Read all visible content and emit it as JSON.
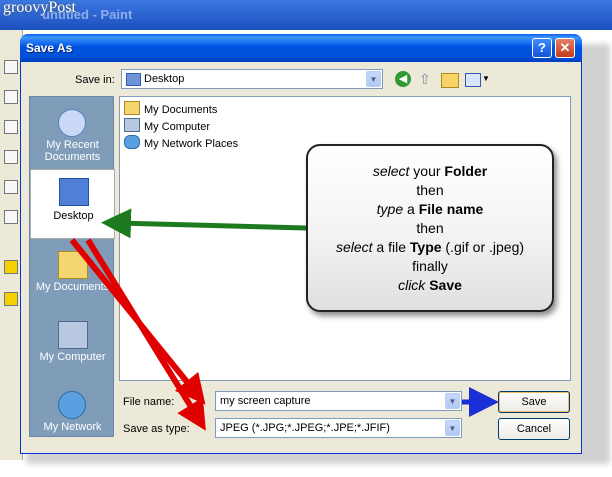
{
  "watermark": "groovyPost",
  "paint": {
    "title": "untitled - Paint"
  },
  "dialog": {
    "title": "Save As",
    "help": "?",
    "close": "✕",
    "save_in_label": "Save in:",
    "save_in_value": "Desktop",
    "places": [
      "My Recent Documents",
      "Desktop",
      "My Documents",
      "My Computer",
      "My Network"
    ],
    "files": [
      "My Documents",
      "My Computer",
      "My Network Places"
    ],
    "file_name_label": "File name:",
    "file_name_value": "my screen capture",
    "save_type_label": "Save as type:",
    "save_type_value": "JPEG (*.JPG;*.JPEG;*.JPE;*.JFIF)",
    "save_button": "Save",
    "cancel_button": "Cancel"
  },
  "callout": {
    "l1_em": "select",
    "l1_rest": " your ",
    "l1_bold": "Folder",
    "l2": "then",
    "l3_em": "type",
    "l3_rest": " a ",
    "l3_bold": "File name",
    "l4": "then",
    "l5_em": "select",
    "l5_rest": " a file ",
    "l5_bold": "Type",
    "l5_tail": " (.gif or .jpeg)",
    "l6": "finally",
    "l7_em": "click",
    "l7_bold": "Save"
  },
  "colors": {
    "green_arrow": "#1e7a1e",
    "red_arrow": "#e00000",
    "blue_arrow": "#1a2fd6",
    "titlebar": "#0053e1"
  }
}
